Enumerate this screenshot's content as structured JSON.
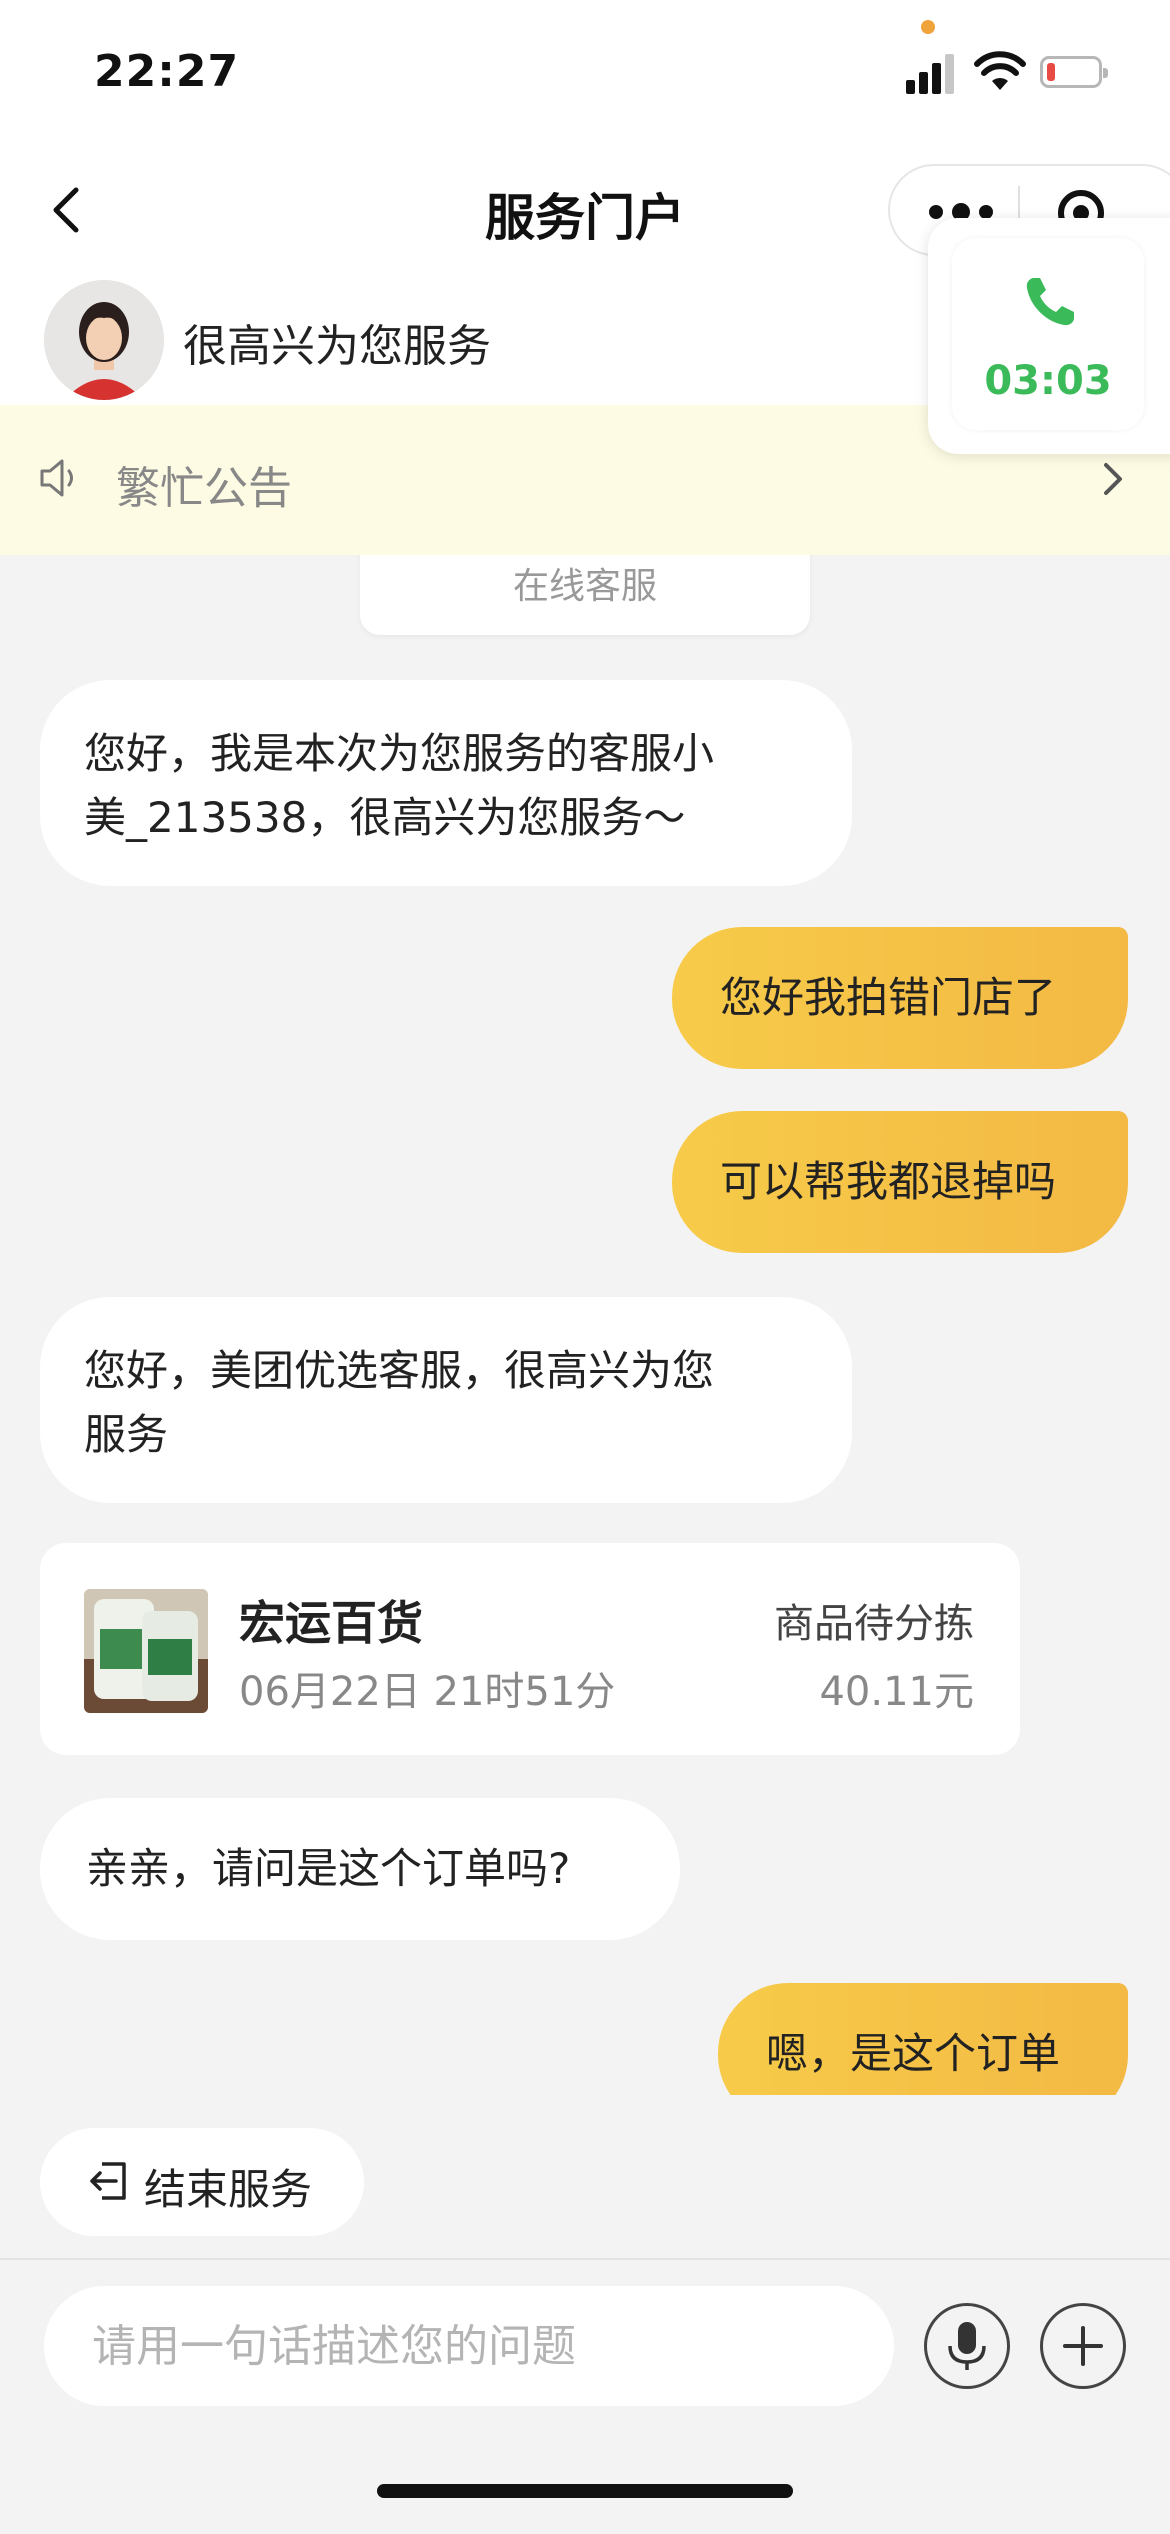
{
  "status_bar": {
    "time": "22:27"
  },
  "nav": {
    "title": "服务门户"
  },
  "agent": {
    "greeting": "很高兴为您服务"
  },
  "notice": {
    "text": "繁忙公告"
  },
  "call": {
    "duration": "03:03"
  },
  "chat": {
    "system_label": "在线客服",
    "messages": [
      {
        "side": "left",
        "lines": [
          "您好，我是本次为您服务的客服小",
          "美_213538，很高兴为您服务～"
        ]
      },
      {
        "side": "right",
        "text": "您好我拍错门店了"
      },
      {
        "side": "right",
        "text": "可以帮我都退掉吗"
      },
      {
        "side": "left",
        "lines": [
          "您好，美团优选客服，很高兴为您",
          "服务"
        ]
      },
      {
        "side": "left",
        "text": "亲亲，请问是这个订单吗?"
      },
      {
        "side": "right",
        "text": "嗯，是这个订单"
      }
    ],
    "order": {
      "shop": "宏运百货",
      "datetime": "06月22日 21时51分",
      "status": "商品待分拣",
      "price": "40.11元"
    }
  },
  "end_service": {
    "label": "结束服务"
  },
  "input": {
    "placeholder": "请用一句话描述您的问题"
  },
  "colors": {
    "accent": "#f5c247",
    "call_green": "#3bba5a",
    "notice_bg": "#fdfbe3"
  }
}
